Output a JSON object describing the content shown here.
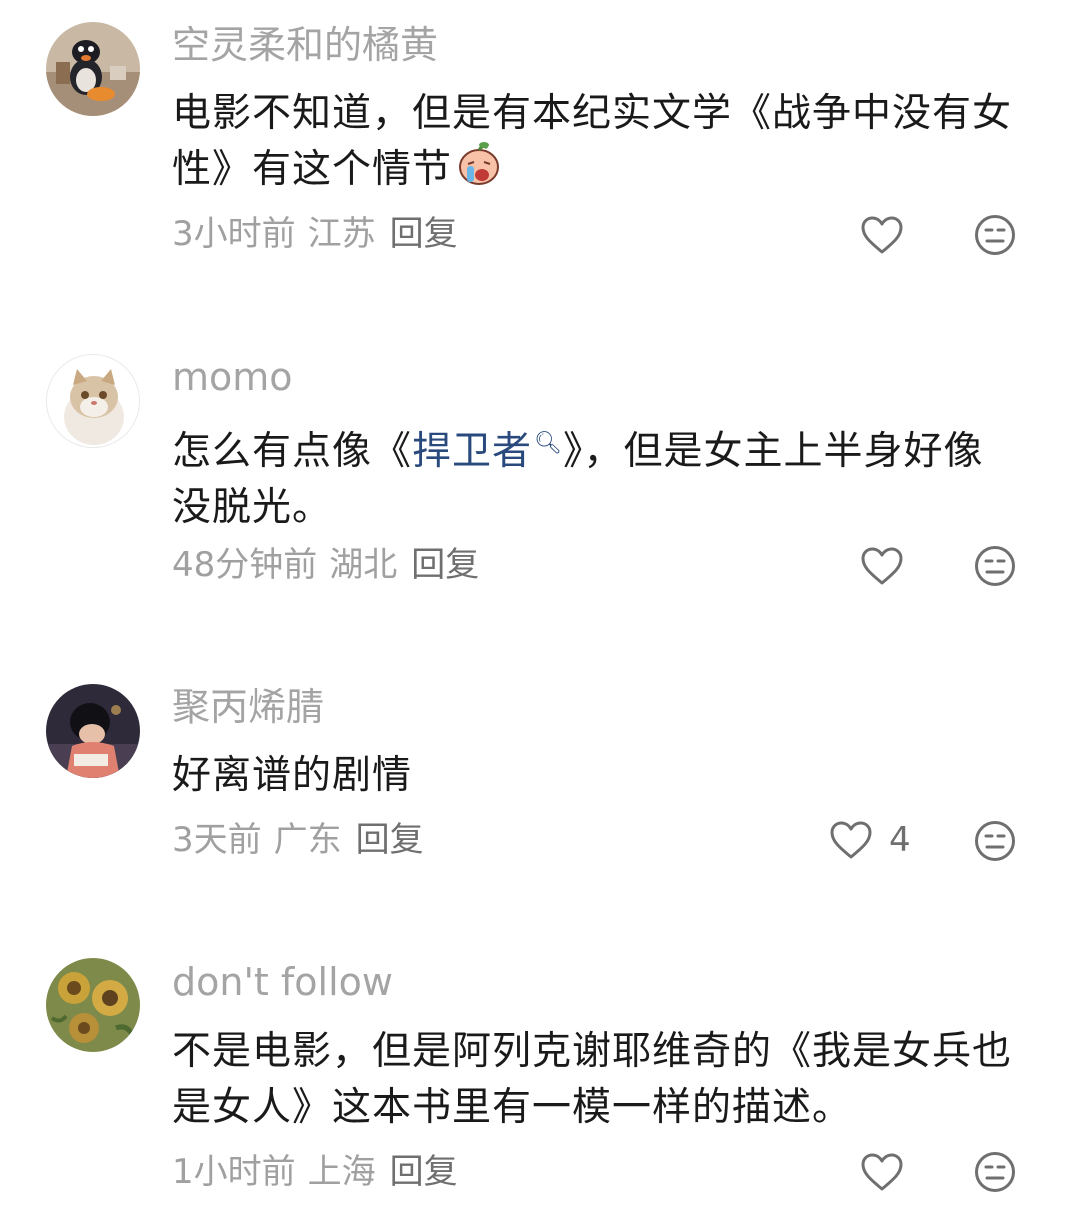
{
  "comments": [
    {
      "username": "空灵柔和的橘黄",
      "text_part1": "电影不知道，但是有本纪实文学《战争中没有女性》有这个情节",
      "emoji": "crying-face-emoji",
      "time": "3小时前",
      "location": "江苏",
      "reply_label": "回复",
      "like_count": "",
      "avatar_icon": "penguin-avatar"
    },
    {
      "username": "momo",
      "text_part1": "怎么有点像《",
      "topic_link": "捍卫者",
      "text_part2": "》，但是女主上半身好像没脱光。",
      "time": "48分钟前",
      "location": "湖北",
      "reply_label": "回复",
      "like_count": "",
      "avatar_icon": "cat-avatar"
    },
    {
      "username": "聚丙烯腈",
      "text_part1": "好离谱的剧情",
      "time": "3天前",
      "location": "广东",
      "reply_label": "回复",
      "like_count": "4",
      "avatar_icon": "boy-reading-avatar"
    },
    {
      "username": "don't follow",
      "text_part1": "不是电影，但是阿列克谢耶维奇的《我是女兵也是女人》这本书里有一模一样的描述。",
      "time": "1小时前",
      "location": "上海",
      "reply_label": "回复",
      "like_count": "",
      "avatar_icon": "sunflower-painting-avatar"
    }
  ],
  "icons": {
    "like": "heart-outline-icon",
    "dislike": "meh-face-icon",
    "topic_search": "search-icon"
  },
  "colors": {
    "username": "#a4a4a4",
    "body": "#1a1a1a",
    "meta": "#a0a0a0",
    "reply": "#6f6f6f",
    "topic_link": "#2a4a7d",
    "icon": "#6f6f6f"
  }
}
